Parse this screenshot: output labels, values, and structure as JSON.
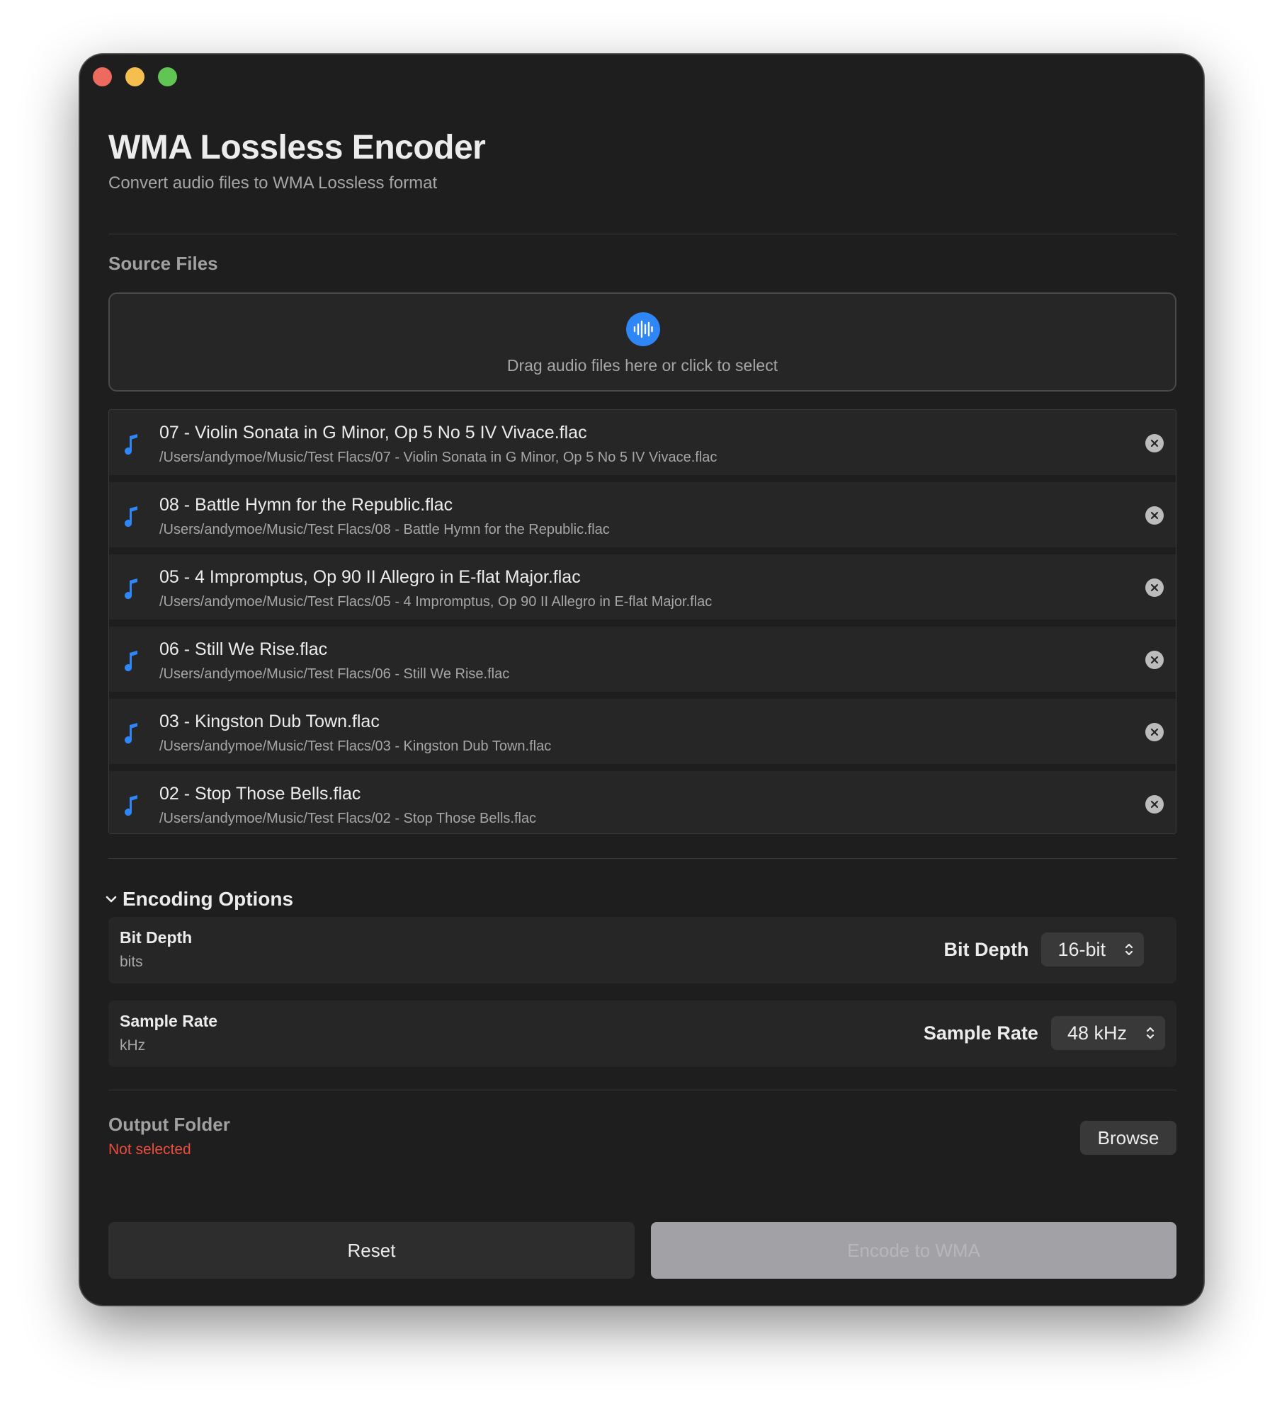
{
  "app": {
    "title": "WMA Lossless Encoder",
    "subtitle": "Convert audio files to WMA Lossless format"
  },
  "source": {
    "section_label": "Source Files",
    "dropzone_text": "Drag audio files here or click to select",
    "dropzone_icon": "waveform-icon",
    "files": [
      {
        "name": "07 - Violin Sonata in G Minor, Op  5 No  5  IV  Vivace.flac",
        "path": "/Users/andymoe/Music/Test Flacs/07 - Violin Sonata in G Minor, Op  5 No  5  IV  Vivace.flac"
      },
      {
        "name": "08 - Battle Hymn for the Republic.flac",
        "path": "/Users/andymoe/Music/Test Flacs/08 - Battle Hymn for the Republic.flac"
      },
      {
        "name": "05 - 4 Impromptus, Op 90  II  Allegro in E-flat Major.flac",
        "path": "/Users/andymoe/Music/Test Flacs/05 - 4 Impromptus, Op 90  II  Allegro in E-flat Major.flac"
      },
      {
        "name": "06 - Still We Rise.flac",
        "path": "/Users/andymoe/Music/Test Flacs/06 - Still We Rise.flac"
      },
      {
        "name": "03 - Kingston Dub Town.flac",
        "path": "/Users/andymoe/Music/Test Flacs/03 - Kingston Dub Town.flac"
      },
      {
        "name": "02 - Stop Those Bells.flac",
        "path": "/Users/andymoe/Music/Test Flacs/02 - Stop Those Bells.flac"
      }
    ]
  },
  "encoding": {
    "section_label": "Encoding Options",
    "bit_depth": {
      "title": "Bit Depth",
      "unit": "bits",
      "control_label": "Bit Depth",
      "value": "16-bit"
    },
    "sample_rate": {
      "title": "Sample Rate",
      "unit": "kHz",
      "control_label": "Sample Rate",
      "value": "48 kHz"
    }
  },
  "output": {
    "title": "Output Folder",
    "status": "Not selected",
    "browse_label": "Browse"
  },
  "actions": {
    "reset_label": "Reset",
    "encode_label": "Encode to WMA"
  },
  "colors": {
    "accent": "#2f86f6",
    "error": "#ec4d3d",
    "window_bg": "#1e1e1e"
  }
}
